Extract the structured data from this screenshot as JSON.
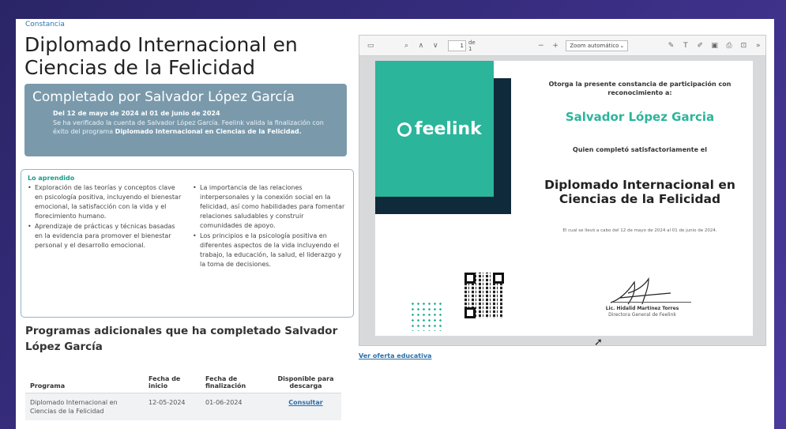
{
  "breadcrumb": "Constancia",
  "page_title": "Diplomado Internacional en Ciencias de la Felicidad",
  "completed": {
    "heading": "Completado por Salvador López García",
    "dates": "Del 12 de mayo de 2024 al 01 de junio de 2024",
    "desc_prefix": "Se ha verificado la cuenta de Salvador López García. Feelink valida la finalización con éxito del programa ",
    "desc_program": "Diplomado Internacional en Ciencias de la Felicidad."
  },
  "learned": {
    "label": "Lo aprendido",
    "col1": [
      "Exploración de las teorías y conceptos clave en psicología positiva, incluyendo el bienestar emocional, la satisfacción con la vida y el florecimiento humano.",
      "Aprendizaje de prácticas y técnicas basadas en la evidencia para promover el bienestar personal y el desarrollo emocional."
    ],
    "col2": [
      "La importancia de las relaciones interpersonales y la conexión social en la felicidad, así como habilidades para fomentar relaciones saludables y construir comunidades de apoyo.",
      "Los principios e la psicología positiva en diferentes aspectos de la vida incluyendo el trabajo, la educación, la salud, el liderazgo y la toma de decisiones."
    ]
  },
  "programs": {
    "title": "Programas adicionales que ha completado Salvador López García",
    "headers": [
      "Programa",
      "Fecha de inicio",
      "Fecha de finalización",
      "Disponible para descarga"
    ],
    "rows": [
      {
        "program": "Diplomado Internacional en Ciencias de la Felicidad",
        "start": "12-05-2024",
        "end": "01-06-2024",
        "action": "Consultar"
      }
    ]
  },
  "viewer": {
    "page_value": "1",
    "page_of": "de 1",
    "zoom": "Zoom automático",
    "icons": [
      "sidebar-toggle-icon",
      "search-icon",
      "prev-page-icon",
      "next-page-icon",
      "zoom-out-icon",
      "zoom-in-icon",
      "highlight-icon",
      "text-icon",
      "draw-icon",
      "image-icon",
      "print-icon",
      "save-icon",
      "more-tools-icon"
    ]
  },
  "certificate": {
    "logo": "feelink",
    "intro": "Otorga la presente constancia de participación con reconocimiento a:",
    "name": "Salvador López Garcia",
    "completed_text": "Quien completó satisfactoriamente el",
    "diploma": "Diplomado Internacional en Ciencias de la Felicidad",
    "period": "El cual se llevó a cabo del 12 de mayo de 2024 al 01 de junio de 2024.",
    "signer_name": "Lic. Hidalid Martínez Torres",
    "signer_role": "Directora General de Feelink"
  },
  "offer_link": "Ver oferta educativa",
  "colors": {
    "teal": "#2bb59b",
    "navy": "#0f2a3a",
    "completed_bg": "#7a9aac",
    "link": "#2a6ea8"
  }
}
